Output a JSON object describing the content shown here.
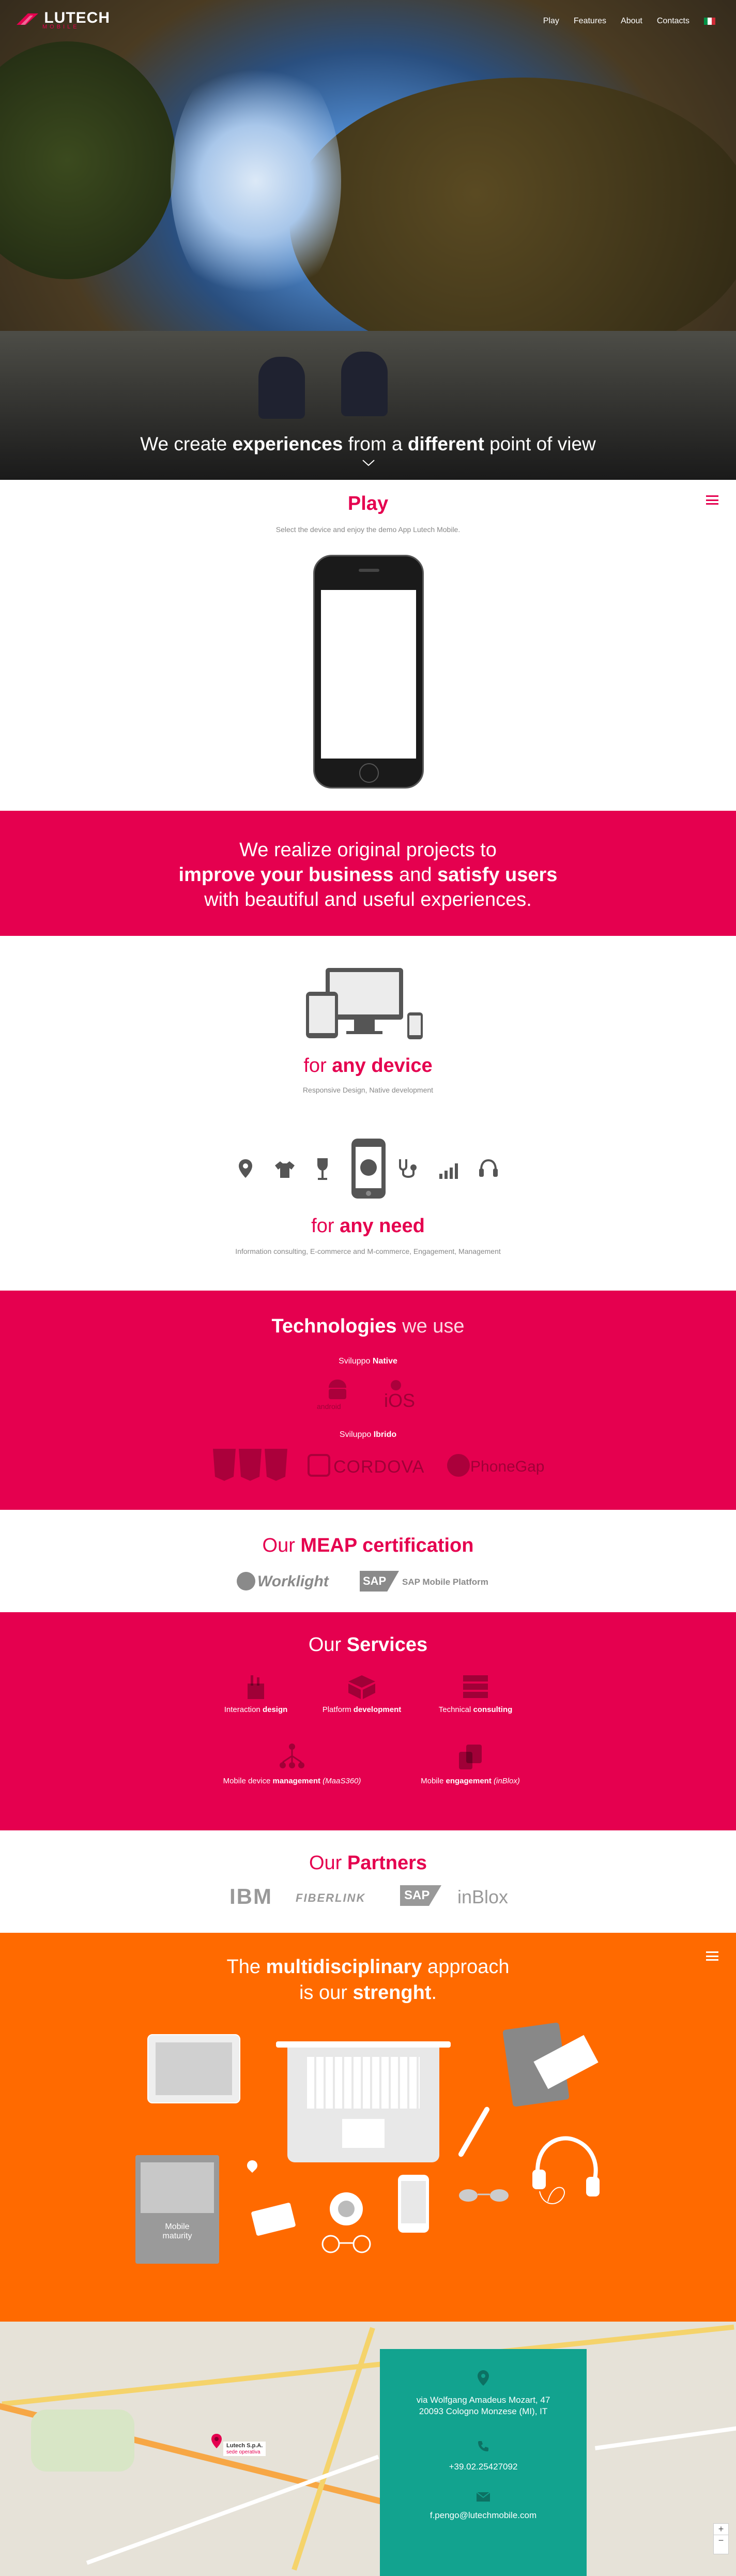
{
  "nav": {
    "logo_text": "LUTECH",
    "logo_sub": "MOBILE",
    "links": [
      "Play",
      "Features",
      "About",
      "Contacts"
    ]
  },
  "hero": {
    "tagline_pre": "We create ",
    "tagline_b1": "experiences",
    "tagline_mid": " from a ",
    "tagline_b2": "different",
    "tagline_post": " point of view"
  },
  "play": {
    "title": "Play",
    "subtitle": "Select the device and enjoy the demo App Lutech Mobile."
  },
  "banner": {
    "line1": "We realize original projects to",
    "line2_b1": "improve your business",
    "line2_mid": " and ",
    "line2_b2": "satisfy users",
    "line3": "with beautiful and useful experiences."
  },
  "device": {
    "title_pre": "for ",
    "title_b": "any device",
    "subtitle": "Responsive Design, Native development"
  },
  "need": {
    "title_pre": "for ",
    "title_b": "any need",
    "subtitle": "Information consulting, E-commerce and M-commerce, Engagement, Management"
  },
  "tech": {
    "title_b": "Technologies",
    "title_post": " we use",
    "native_pre": "Sviluppo ",
    "native_b": "Native",
    "android": "android",
    "ios": "iOS",
    "hybrid_pre": "Sviluppo ",
    "hybrid_b": "Ibrido",
    "cordova": "CORDOVA",
    "phonegap": "PhoneGap"
  },
  "meap": {
    "title_pre": "Our ",
    "title_b": "MEAP certification",
    "worklight": "Worklight",
    "sap": "SAP Mobile Platform"
  },
  "services": {
    "title_pre": "Our ",
    "title_b": "Services",
    "items": [
      {
        "pre": "Interaction ",
        "b": "design",
        "post": ""
      },
      {
        "pre": "Platform ",
        "b": "development",
        "post": ""
      },
      {
        "pre": "Technical ",
        "b": "consulting",
        "post": ""
      },
      {
        "pre": "Mobile device ",
        "b": "management",
        "post": " (MaaS360)"
      },
      {
        "pre": "Mobile ",
        "b": "engagement",
        "post": " (inBlox)"
      }
    ]
  },
  "partners": {
    "title_pre": "Our ",
    "title_b": "Partners",
    "logos": [
      "IBM",
      "FIBERLINK",
      "SAP",
      "inBlox"
    ]
  },
  "approach": {
    "pre": "The ",
    "b1": "multidisciplinary",
    "mid": " approach",
    "line2_pre": "is our ",
    "b2": "strenght",
    "line2_post": ".",
    "book_label": "Mobile maturity"
  },
  "contact": {
    "address1": "via Wolfgang Amadeus Mozart, 47",
    "address2": "20093 Cologno Monzese (MI), IT",
    "phone": "+39.02.25427092",
    "email": "f.pengo@lutechmobile.com",
    "marker_label": "Lutech S.p.A.",
    "marker_sub": "sede operativa"
  },
  "colors": {
    "pink": "#e5004f",
    "orange": "#ff6a00",
    "teal": "#12a38f"
  }
}
